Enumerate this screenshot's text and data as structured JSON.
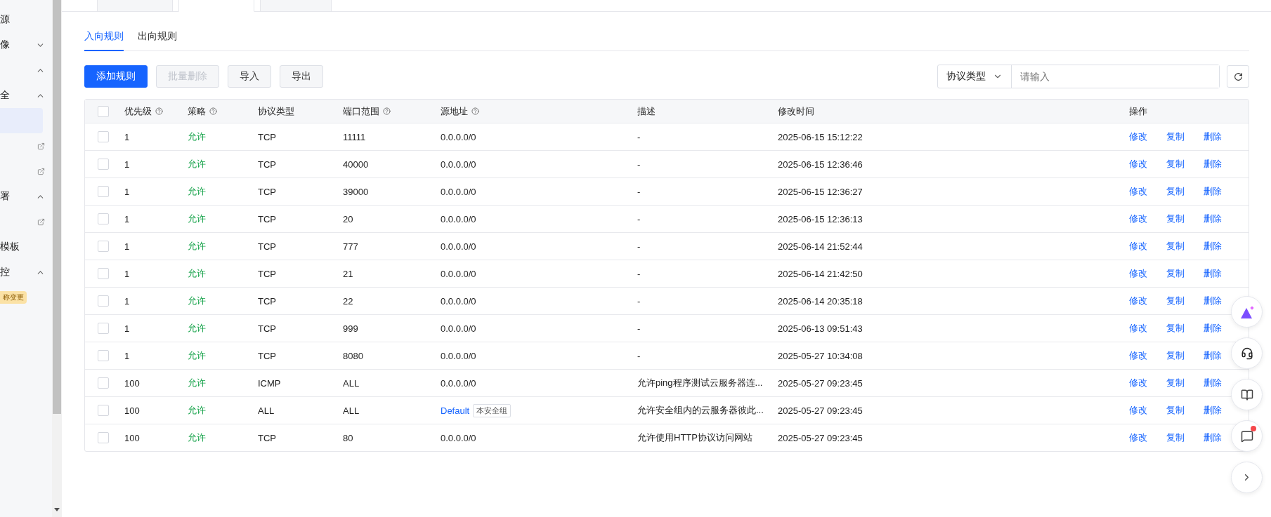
{
  "sidebar": {
    "items": [
      {
        "kind": "item",
        "label": "源"
      },
      {
        "kind": "group",
        "label": "像",
        "expanded": false
      },
      {
        "kind": "group",
        "expanded": true
      },
      {
        "kind": "group",
        "label": "全",
        "expanded": true
      },
      {
        "kind": "item",
        "selected": true
      },
      {
        "kind": "link"
      },
      {
        "kind": "link"
      },
      {
        "kind": "group",
        "label": "署",
        "expanded": true
      },
      {
        "kind": "link"
      },
      {
        "kind": "item",
        "label": "模板"
      },
      {
        "kind": "group",
        "label": "控",
        "expanded": true
      },
      {
        "kind": "badge",
        "label": "称变更"
      }
    ]
  },
  "top_tabs": [
    {
      "selected": false
    },
    {
      "selected": true
    },
    {
      "selected": false
    }
  ],
  "sub_tabs": [
    {
      "label": "入向规则",
      "selected": true
    },
    {
      "label": "出向规则",
      "selected": false
    }
  ],
  "toolbar": {
    "buttons": [
      {
        "label": "添加规则",
        "kind": "primary",
        "disabled": false
      },
      {
        "label": "批量删除",
        "kind": "default",
        "disabled": true
      },
      {
        "label": "导入",
        "kind": "default",
        "disabled": false
      },
      {
        "label": "导出",
        "kind": "default",
        "disabled": false
      }
    ],
    "filter": {
      "select": "协议类型",
      "placeholder": "请输入"
    }
  },
  "table": {
    "columns": [
      {
        "label": "优先级",
        "help": true
      },
      {
        "label": "策略",
        "help": true
      },
      {
        "label": "协议类型",
        "help": false
      },
      {
        "label": "端口范围",
        "help": true
      },
      {
        "label": "源地址",
        "help": true
      },
      {
        "label": "描述",
        "help": false
      },
      {
        "label": "修改时间",
        "help": false
      },
      {
        "label": "操作",
        "help": false
      }
    ],
    "header_checked": false,
    "rows": [
      {
        "checked": false,
        "priority": "1",
        "policy": "允许",
        "protocol": "TCP",
        "port": "11111",
        "source": "0.0.0.0/0",
        "description": "-",
        "time": "2025-06-15 15:12:22",
        "actions": [
          "修改",
          "复制",
          "删除"
        ]
      },
      {
        "checked": false,
        "priority": "1",
        "policy": "允许",
        "protocol": "TCP",
        "port": "40000",
        "source": "0.0.0.0/0",
        "description": "-",
        "time": "2025-06-15 12:36:46",
        "actions": [
          "修改",
          "复制",
          "删除"
        ]
      },
      {
        "checked": false,
        "priority": "1",
        "policy": "允许",
        "protocol": "TCP",
        "port": "39000",
        "source": "0.0.0.0/0",
        "description": "-",
        "time": "2025-06-15 12:36:27",
        "actions": [
          "修改",
          "复制",
          "删除"
        ]
      },
      {
        "checked": false,
        "priority": "1",
        "policy": "允许",
        "protocol": "TCP",
        "port": "20",
        "source": "0.0.0.0/0",
        "description": "-",
        "time": "2025-06-15 12:36:13",
        "actions": [
          "修改",
          "复制",
          "删除"
        ]
      },
      {
        "checked": false,
        "priority": "1",
        "policy": "允许",
        "protocol": "TCP",
        "port": "777",
        "source": "0.0.0.0/0",
        "description": "-",
        "time": "2025-06-14 21:52:44",
        "actions": [
          "修改",
          "复制",
          "删除"
        ]
      },
      {
        "checked": false,
        "priority": "1",
        "policy": "允许",
        "protocol": "TCP",
        "port": "21",
        "source": "0.0.0.0/0",
        "description": "-",
        "time": "2025-06-14 21:42:50",
        "actions": [
          "修改",
          "复制",
          "删除"
        ]
      },
      {
        "checked": false,
        "priority": "1",
        "policy": "允许",
        "protocol": "TCP",
        "port": "22",
        "source": "0.0.0.0/0",
        "description": "-",
        "time": "2025-06-14 20:35:18",
        "actions": [
          "修改",
          "复制",
          "删除"
        ]
      },
      {
        "checked": false,
        "priority": "1",
        "policy": "允许",
        "protocol": "TCP",
        "port": "999",
        "source": "0.0.0.0/0",
        "description": "-",
        "time": "2025-06-13 09:51:43",
        "actions": [
          "修改",
          "复制",
          "删除"
        ]
      },
      {
        "checked": false,
        "priority": "1",
        "policy": "允许",
        "protocol": "TCP",
        "port": "8080",
        "source": "0.0.0.0/0",
        "description": "-",
        "time": "2025-05-27 10:34:08",
        "actions": [
          "修改",
          "复制",
          "删除"
        ]
      },
      {
        "checked": false,
        "priority": "100",
        "policy": "允许",
        "protocol": "ICMP",
        "port": "ALL",
        "source": "0.0.0.0/0",
        "description": "允许ping程序测试云服务器连...",
        "time": "2025-05-27 09:23:45",
        "actions": [
          "修改",
          "复制",
          "删除"
        ]
      },
      {
        "checked": false,
        "priority": "100",
        "policy": "允许",
        "protocol": "ALL",
        "port": "ALL",
        "source": "Default",
        "source_tag": "本安全组",
        "description": "允许安全组内的云服务器彼此...",
        "time": "2025-05-27 09:23:45",
        "actions": [
          "修改",
          "复制",
          "删除"
        ]
      },
      {
        "checked": false,
        "priority": "100",
        "policy": "允许",
        "protocol": "TCP",
        "port": "80",
        "source": "0.0.0.0/0",
        "description": "允许使用HTTP协议访问网站",
        "time": "2025-05-27 09:23:45",
        "actions": [
          "修改",
          "复制",
          "删除"
        ]
      }
    ]
  },
  "float_buttons": [
    {
      "kind": "assistant"
    },
    {
      "kind": "support"
    },
    {
      "kind": "docs"
    },
    {
      "kind": "messages",
      "unread": true
    },
    {
      "kind": "collapse"
    }
  ]
}
